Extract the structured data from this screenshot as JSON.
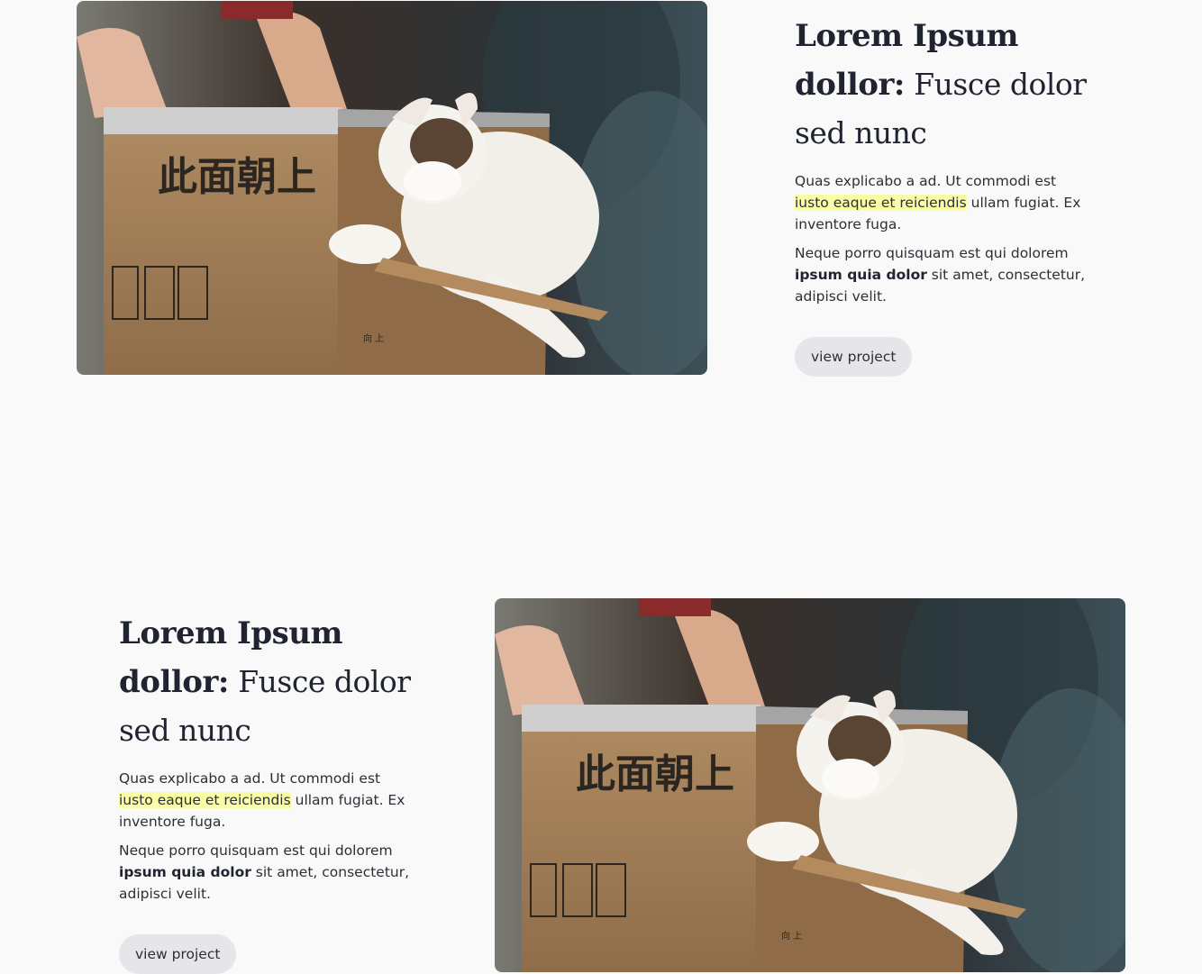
{
  "projects": [
    {
      "heading_strong": "Lorem Ipsum dollor:",
      "heading_rest": "Fusce dolor sed nunc",
      "p1_before": "Quas explicabo a ad. Ut commodi est ",
      "p1_highlight": "iusto eaque et reiciendis",
      "p1_after": " ullam fugiat. Ex inventore fuga.",
      "p2_before": "Neque porro quisquam est qui dolorem ",
      "p2_bold": "ipsum quia dolor",
      "p2_after": " sit amet, consectetur, adipisci velit.",
      "button_label": "view project",
      "image_label": "cat-in-cardboard-box photo",
      "box_print": "此面朝上",
      "box_small_label": "向 上"
    },
    {
      "heading_strong": "Lorem Ipsum dollor:",
      "heading_rest": "Fusce dolor sed nunc",
      "p1_before": "Quas explicabo a ad. Ut commodi est ",
      "p1_highlight": "iusto eaque et reiciendis",
      "p1_after": " ullam fugiat. Ex inventore fuga.",
      "p2_before": "Neque porro quisquam est qui dolorem ",
      "p2_bold": "ipsum quia dolor",
      "p2_after": " sit amet, consectetur, adipisci velit.",
      "button_label": "view project",
      "image_label": "cat-in-cardboard-box photo",
      "box_print": "此面朝上",
      "box_small_label": "向 上"
    }
  ]
}
